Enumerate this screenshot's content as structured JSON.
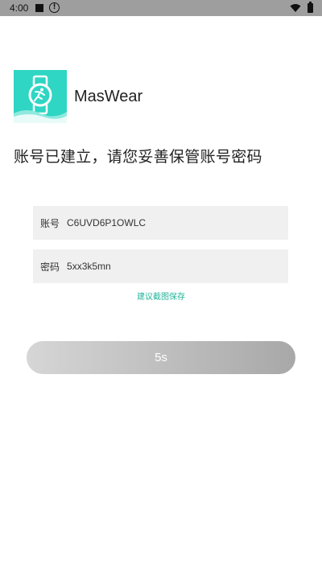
{
  "status_bar": {
    "time": "4:00",
    "icons": [
      "notification-square-icon",
      "alert-circle-icon",
      "wifi-icon",
      "battery-icon"
    ]
  },
  "app": {
    "name": "MasWear",
    "logo_icon": "smartwatch-run-icon",
    "logo_color": "#2ed6c3"
  },
  "heading": "账号已建立，请您妥善保管账号密码",
  "account": {
    "label": "账号",
    "value": "C6UVD6P1OWLC"
  },
  "password": {
    "label": "密码",
    "value": "5xx3k5mn"
  },
  "hint": "建议截图保存",
  "hint_color": "#22b49a",
  "countdown_button": {
    "label": "5s"
  }
}
